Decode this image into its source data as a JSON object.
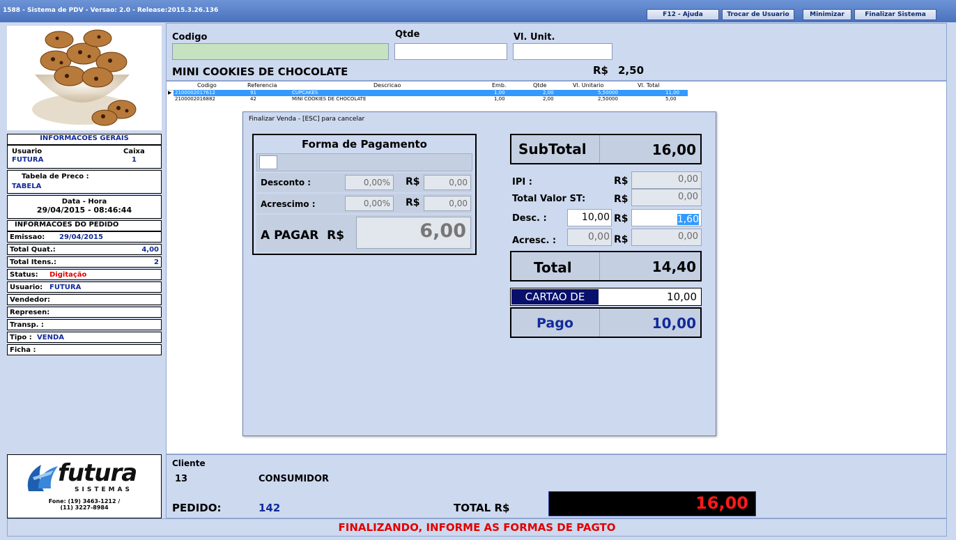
{
  "window": {
    "title": "1588 - Sistema de PDV - Versao: 2.0 - Release:2015.3.26.136",
    "buttons": {
      "help": "F12 - Ajuda",
      "switch_user": "Trocar de Usuario",
      "minimize": "Minimizar",
      "exit": "Finalizar Sistema"
    }
  },
  "left": {
    "geral_header": "INFORMACOES GERAIS",
    "usuario_label": "Usuario",
    "usuario": "FUTURA",
    "caixa_label": "Caixa",
    "caixa": "1",
    "tabela_label": "Tabela de Preco :",
    "tabela": "TABELA",
    "datahora_label": "Data - Hora",
    "datahora": "29/04/2015 - 08:46:44",
    "pedido_header": "INFORMACOES DO PEDIDO",
    "emissao_label": "Emissao:",
    "emissao": "29/04/2015",
    "quat_label": "Total Quat.:",
    "quat": "4,00",
    "itens_label": "Total Itens.:",
    "itens": "2",
    "status_label": "Status:",
    "status": "Digitação",
    "usuario2_label": "Usuario:",
    "usuario2": "FUTURA",
    "vendedor_label": "Vendedor:",
    "represen_label": "Represen:",
    "transp_label": "Transp. :",
    "tipo_label": "Tipo :",
    "tipo": "VENDA",
    "ficha_label": "Ficha :",
    "logo_text": "futura",
    "logo_sub": "SISTEMAS",
    "fone1": "Fone: (19) 3463-1212 /",
    "fone2": "(11) 3227-8984"
  },
  "form": {
    "codigo_label": "Codigo",
    "qtde_label": "Qtde",
    "vlunit_label": "Vl. Unit.",
    "codigo": "",
    "qtde": "",
    "vlunit": "",
    "product": "MINI COOKIES DE CHOCOLATE",
    "price_label": "R$",
    "price": "2,50"
  },
  "grid": {
    "headers": [
      "Codigo",
      "Referencia",
      "Descricao",
      "Emb.",
      "Qtde",
      "Vl. Unitario",
      "Vl. Total"
    ],
    "rows": [
      [
        "2100002017612",
        "91",
        "CUPCAKES",
        "1,00",
        "2,00",
        "5,50000",
        "11,00"
      ],
      [
        "2100002016882",
        "42",
        "MINI COOKIES DE CHOCOLATE",
        "1,00",
        "2,00",
        "2,50000",
        "5,00"
      ]
    ]
  },
  "dialog": {
    "title": "Finalizar Venda - [ESC] para cancelar",
    "forma_title": "Forma de Pagamento",
    "desconto_label": "Desconto :",
    "desconto_pct": "0,00%",
    "desconto_rs": "0,00",
    "acrescimo_label": "Acrescimo :",
    "acrescimo_pct": "0,00%",
    "acrescimo_rs": "0,00",
    "rs": "R$",
    "apagar_label": "A PAGAR  R$",
    "apagar": "6,00",
    "subtotal_label": "SubTotal",
    "subtotal": "16,00",
    "ipi_label": "IPI :",
    "ipi": "0,00",
    "st_label": "Total Valor ST:",
    "st": "0,00",
    "desc_label": "Desc. :",
    "desc_pct": "10,00",
    "desc_rs": "1,60",
    "acresc_label": "Acresc. :",
    "acresc_pct": "0,00",
    "acresc_rs": "0,00",
    "total_label": "Total",
    "total": "14,40",
    "cartao_label": "CARTAO DE",
    "cartao": "10,00",
    "pago_label": "Pago",
    "pago": "10,00"
  },
  "bottom": {
    "cliente_label": "Cliente",
    "cliente_code": "13",
    "cliente_name": "CONSUMIDOR",
    "pedido_label": "PEDIDO:",
    "pedido": "142",
    "total_label": "TOTAL R$",
    "total": "16,00"
  },
  "status": "FINALIZANDO, INFORME AS FORMAS DE PAGTO",
  "colors": {
    "accent_blue": "#112a9a",
    "status_red": "#e00000",
    "selection": "#3399ff",
    "total_bg": "#000000"
  }
}
